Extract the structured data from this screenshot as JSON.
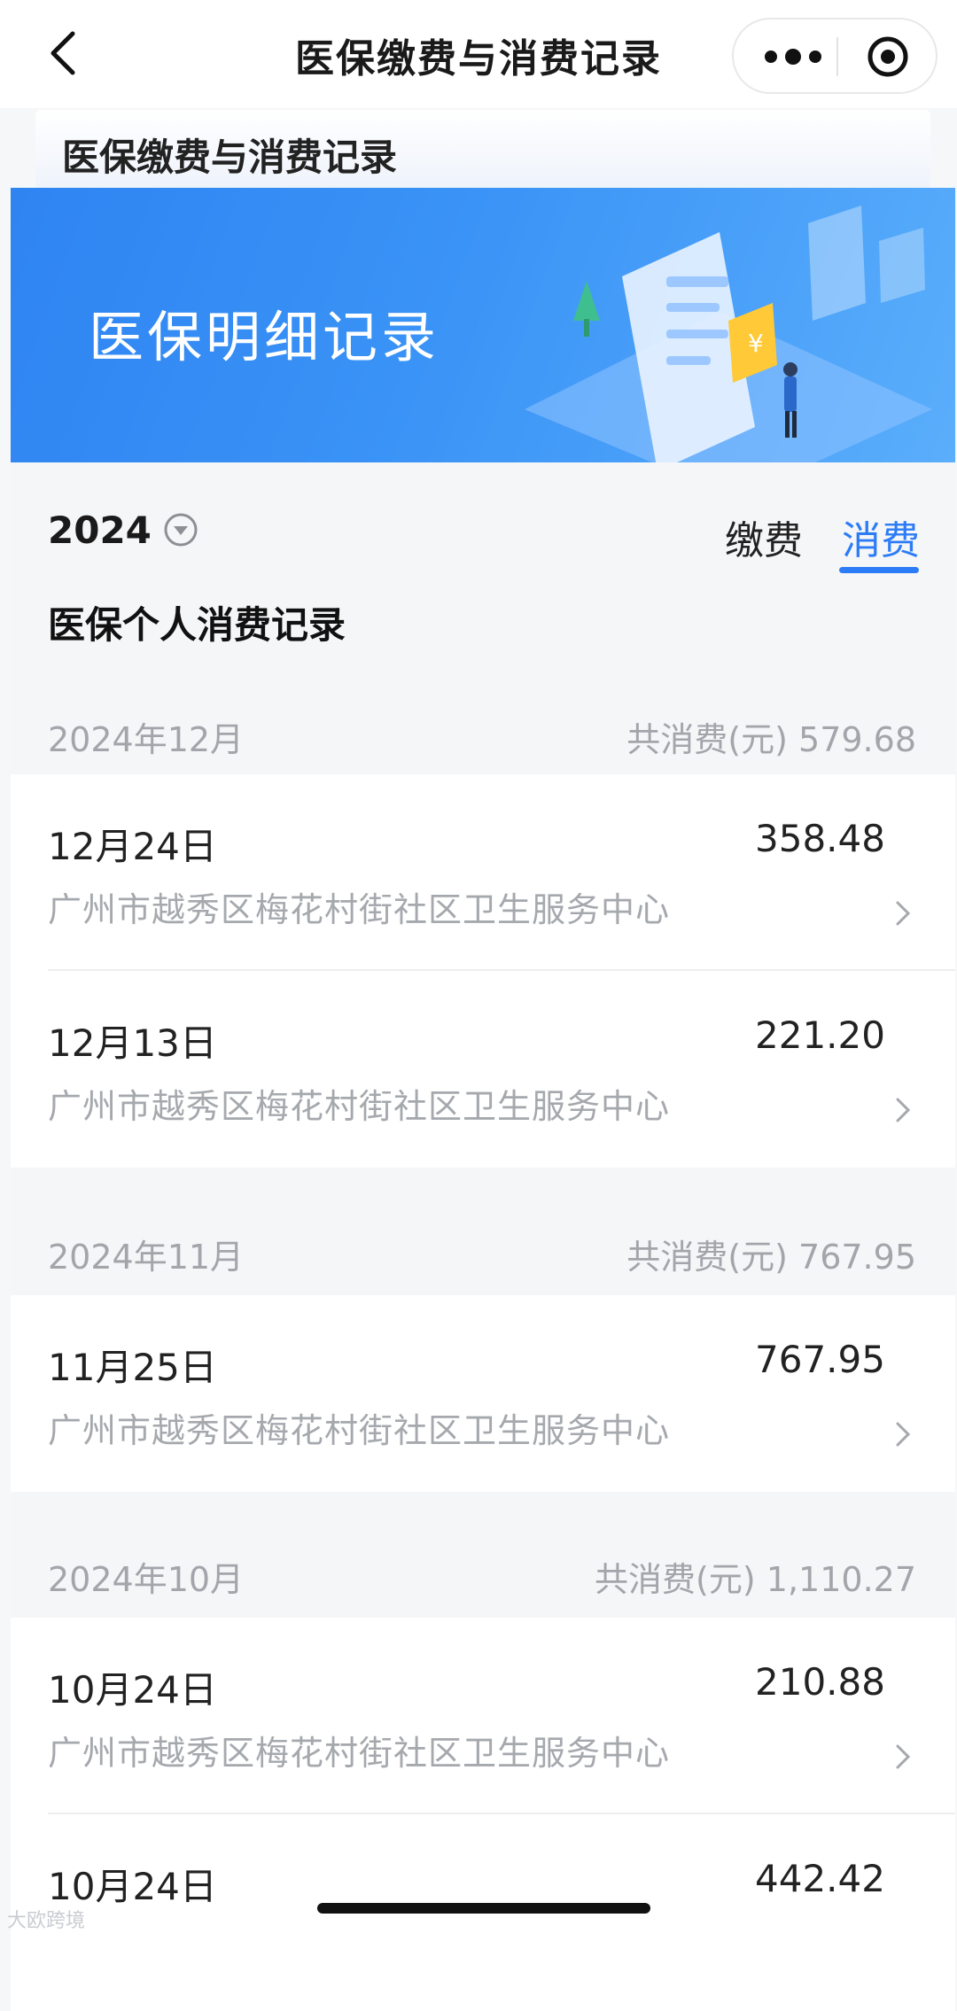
{
  "nav": {
    "title": "医保缴费与消费记录",
    "back_icon": "chevron-left-icon",
    "more_icon": "more-dots-icon",
    "close_icon": "target-circle-icon"
  },
  "header": {
    "title": "医保缴费与消费记录"
  },
  "banner": {
    "title": "医保明细记录"
  },
  "filter": {
    "year": "2024",
    "dropdown_icon": "chevron-down-circle-icon"
  },
  "tabs": [
    {
      "label": "缴费",
      "active": false
    },
    {
      "label": "消费",
      "active": true
    }
  ],
  "section": {
    "title": "医保个人消费记录"
  },
  "months": [
    {
      "label": "2024年12月",
      "total": "共消费(元) 579.68",
      "records": [
        {
          "date": "12月24日",
          "amount": "358.48",
          "place": "广州市越秀区梅花村街社区卫生服务中心"
        },
        {
          "date": "12月13日",
          "amount": "221.20",
          "place": "广州市越秀区梅花村街社区卫生服务中心"
        }
      ]
    },
    {
      "label": "2024年11月",
      "total": "共消费(元) 767.95",
      "records": [
        {
          "date": "11月25日",
          "amount": "767.95",
          "place": "广州市越秀区梅花村街社区卫生服务中心"
        }
      ]
    },
    {
      "label": "2024年10月",
      "total": "共消费(元) 1,110.27",
      "records": [
        {
          "date": "10月24日",
          "amount": "210.88",
          "place": "广州市越秀区梅花村街社区卫生服务中心"
        },
        {
          "date": "10月24日",
          "amount": "442.42",
          "place": ""
        }
      ]
    }
  ],
  "watermark": "大欧跨境",
  "colors": {
    "accent": "#2b7cf6",
    "banner": "#3a8ef5",
    "muted_text": "#a5a8ad"
  }
}
